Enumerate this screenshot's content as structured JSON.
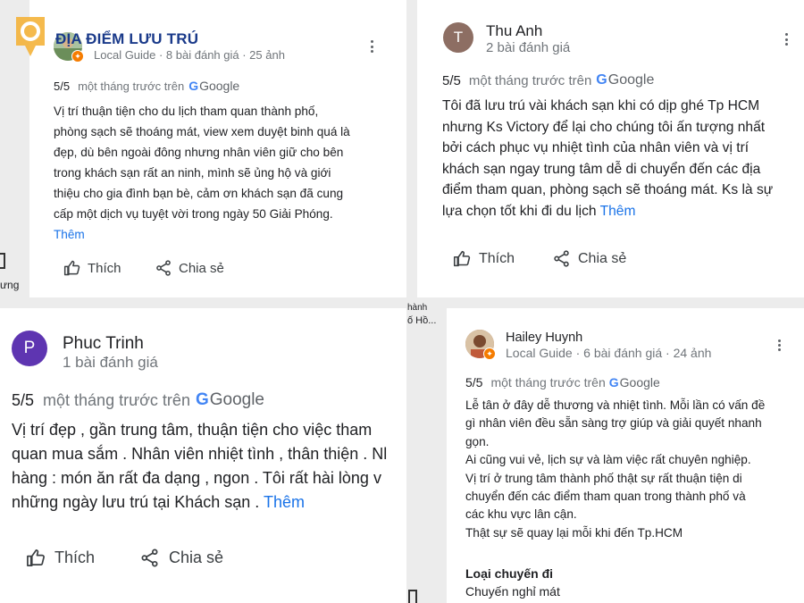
{
  "accent_more": "#1a73e8",
  "logo": {
    "text": "ĐỊA ĐIỂM LƯU TRÚ",
    "icon": "map-pin-logo"
  },
  "review1": {
    "reviewer": "",
    "meta": "Local Guide · 8 bài đánh giá · 25 ảnh",
    "score": "5/5",
    "when": "một tháng trước trên",
    "source_letter": "G",
    "source_word": "Google",
    "lines": [
      "Vị trí thuận tiện cho du lịch tham quan thành phố,",
      "phòng sạch sẽ thoáng mát, view xem duyệt binh quá là",
      "đẹp, dù bên ngoài đông nhưng nhân viên giữ cho bên",
      "trong khách sạn rất an ninh, mình sẽ ủng hộ và giới",
      "thiệu cho gia đình bạn bè, cảm ơn khách sạn đã cung",
      "cấp một dịch vụ tuyệt vời trong ngày 50 Giải Phóng."
    ],
    "more": "Thêm",
    "like": "Thích",
    "share": "Chia sẻ"
  },
  "review2": {
    "avatar_letter": "T",
    "avatar_color": "#8d6e63",
    "reviewer": "Thu Anh",
    "meta": "2 bài đánh giá",
    "score": "5/5",
    "when": "một tháng trước trên",
    "source_letter": "G",
    "source_word": "Google",
    "lines": [
      "Tôi đã lưu trú vài khách sạn khi có dịp ghé Tp HCM",
      "nhưng Ks Victory để lại cho chúng tôi ấn tượng nhất",
      "bởi cách phục vụ nhiệt tình của nhân viên và vị trí",
      "khách sạn ngay trung tâm dễ di chuyển đến các địa",
      "điểm tham quan, phòng sạch sẽ thoáng mát. Ks là sự"
    ],
    "last_line": "lựa chọn tốt khi đi du lịch",
    "more": "Thêm",
    "like": "Thích",
    "share": "Chia sẻ"
  },
  "review3": {
    "avatar_letter": "P",
    "avatar_color": "#5e35b1",
    "reviewer": "Phuc Trinh",
    "meta": "1 bài đánh giá",
    "score": "5/5",
    "when": "một tháng trước trên",
    "source_letter": "G",
    "source_word": "Google",
    "lines": [
      "Vị trí đẹp , gần trung tâm, thuận tiện cho việc tham",
      "quan mua sắm . Nhân viên nhiệt tình , thân thiện . Nl",
      "hàng : món ăn  rất đa dạng , ngon . Tôi rất hài lòng v"
    ],
    "last_line": "những ngày lưu trú tại Khách sạn .",
    "more": "Thêm",
    "like": "Thích",
    "share": "Chia sẻ"
  },
  "review4": {
    "reviewer": "Hailey Huynh",
    "meta": "Local Guide · 6 bài đánh giá · 24 ảnh",
    "score": "5/5",
    "when": "một tháng trước trên",
    "source_letter": "G",
    "source_word": "Google",
    "lines": [
      "Lễ tân ở đây dễ thương và nhiệt tình. Mỗi lần có vấn đề",
      "gì nhân viên đều sẵn sàng trợ giúp và giải quyết nhanh",
      "gọn.",
      "Ai cũng vui vẻ, lịch sự và làm việc rất chuyên nghiệp.",
      "Vị trí ở trung tâm thành phố thật sự rất thuận tiện di",
      "chuyển đến các điểm tham quan trong thành phố và",
      "các khu vực lân cận.",
      "Thật sự sẽ quay lại mỗi khi đến Tp.HCM"
    ],
    "trip_label": "Loại chuyến đi",
    "trip_value": "Chuyến nghỉ mát"
  },
  "fragments": {
    "left_edge": "ưng",
    "mid_top": "hành",
    "mid_bottom": "ố Hồ..."
  }
}
